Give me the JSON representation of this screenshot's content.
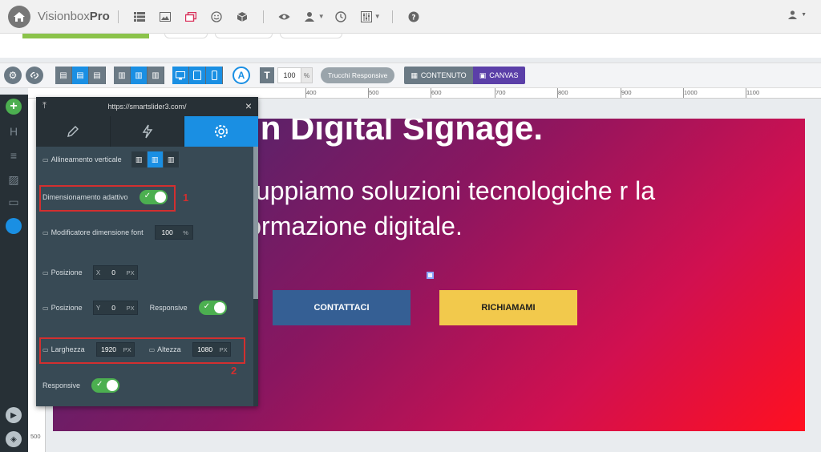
{
  "topbar": {
    "brand_light": "Visionbox",
    "brand_bold": "Pro"
  },
  "toolbar": {
    "font_size_value": "100",
    "font_size_unit": "%",
    "responsive_tricks": "Trucchi Responsive",
    "content_label": "CONTENUTO",
    "canvas_label": "CANVAS"
  },
  "ruler": {
    "top_ticks": [
      "400",
      "500",
      "600",
      "700",
      "800",
      "900",
      "1000",
      "1100"
    ],
    "left_tick": "500"
  },
  "slide": {
    "title": "erti in Digital Signage.",
    "subtitle": "e sviluppiamo soluzioni tecnologiche r la trasformazione digitale.",
    "btn_contact": "CONTATTACI",
    "btn_callback": "RICHIAMAMI"
  },
  "panel": {
    "url": "https://smartslider3.com/",
    "vertical_align": "Allineamento verticale",
    "adaptive_sizing": "Dimensionamento adattivo",
    "font_modifier": "Modificatore dimensione font",
    "font_modifier_value": "100",
    "font_modifier_unit": "%",
    "position_label": "Posizione",
    "pos_x_prefix": "X",
    "pos_x_value": "0",
    "pos_y_prefix": "Y",
    "pos_y_value": "0",
    "unit_px": "PX",
    "responsive": "Responsive",
    "width_label": "Larghezza",
    "width_value": "1920",
    "height_label": "Altezza",
    "height_value": "1080",
    "annot_1": "1",
    "annot_2": "2"
  },
  "colors": {
    "accent": "#1a8fe3",
    "toggle_on": "#4caf50",
    "highlight": "#d32f2f",
    "cta_blue": "#355f94",
    "cta_yellow": "#f2c94c"
  }
}
